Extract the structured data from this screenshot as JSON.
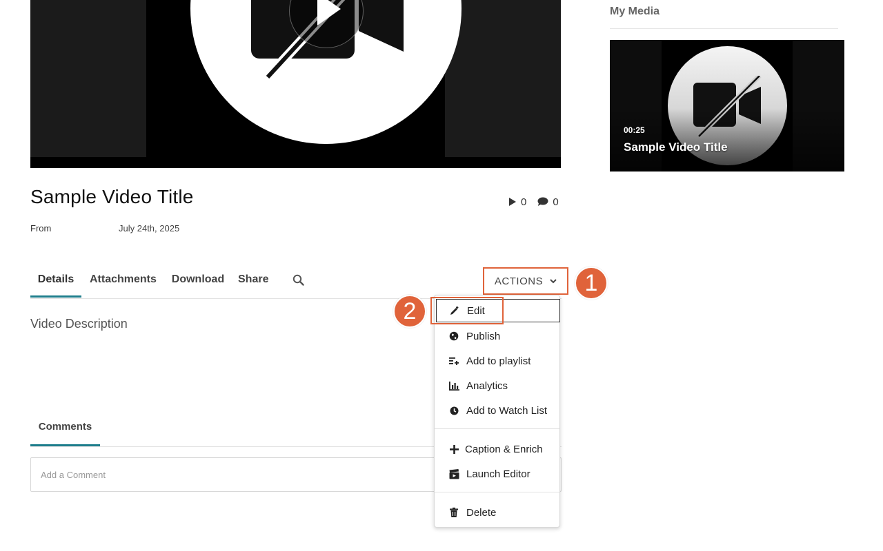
{
  "video": {
    "title": "Sample Video Title",
    "from_label": "From",
    "date": "July 24th, 2025",
    "plays": "0",
    "comments_count": "0",
    "description": "Video Description"
  },
  "tabs": [
    {
      "label": "Details",
      "active": true
    },
    {
      "label": "Attachments",
      "active": false
    },
    {
      "label": "Download",
      "active": false
    },
    {
      "label": "Share",
      "active": false
    }
  ],
  "actions": {
    "label": "ACTIONS",
    "menu": [
      {
        "label": "Edit",
        "icon": "pencil-icon"
      },
      {
        "label": "Publish",
        "icon": "globe-icon"
      },
      {
        "label": "Add to playlist",
        "icon": "playlist-add-icon"
      },
      {
        "label": "Analytics",
        "icon": "bar-chart-icon"
      },
      {
        "label": "Add to Watch List",
        "icon": "clock-icon"
      },
      {
        "label": "Caption & Enrich",
        "icon": "plus-icon"
      },
      {
        "label": "Launch Editor",
        "icon": "clapperboard-icon"
      },
      {
        "label": "Delete",
        "icon": "trash-icon"
      }
    ]
  },
  "callouts": [
    "1",
    "2"
  ],
  "comments": {
    "tab_label": "Comments",
    "placeholder": "Add a Comment"
  },
  "sidebar": {
    "title": "My Media",
    "card": {
      "duration": "00:25",
      "title": "Sample Video Title"
    }
  },
  "colors": {
    "accent": "#1e7e8c",
    "callout": "#e0633a"
  }
}
